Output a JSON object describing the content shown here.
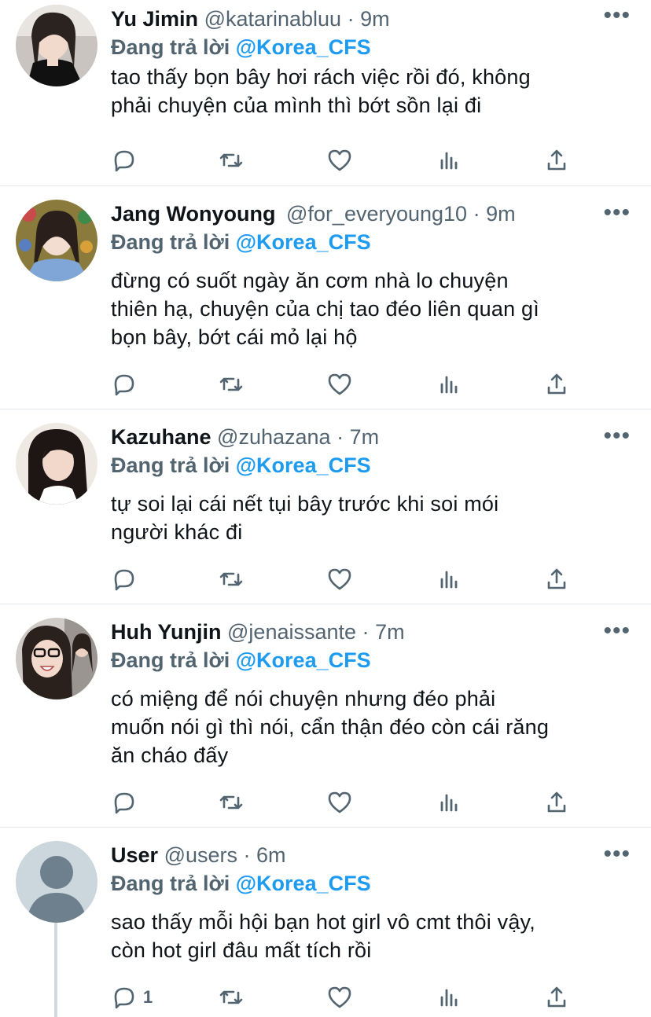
{
  "tweets": [
    {
      "name": "Yu Jimin",
      "handle": "@katarinabluu",
      "dot": "·",
      "time": "9m",
      "more": "•••",
      "reply_prefix": "Đang trả lời",
      "reply_to": "@Korea_CFS",
      "text_lines": [
        "tao thấy bọn bây hơi rách việc rồi đó, không",
        "phải chuyện của mình thì bớt sồn lại đi"
      ],
      "avatar": "profile-photo",
      "reply_count": ""
    },
    {
      "name": "Jang Wonyoung",
      "handle": "@for_everyoung10",
      "dot": "·",
      "time": "9m",
      "more": "•••",
      "reply_prefix": "Đang trả lời",
      "reply_to": "@Korea_CFS",
      "text_lines": [
        "đừng có suốt ngày ăn cơm nhà lo chuyện",
        "thiên hạ, chuyện của chị tao đéo liên quan gì",
        "bọn bây, bớt cái mỏ lại hộ"
      ],
      "avatar": "profile-photo",
      "reply_count": ""
    },
    {
      "name": "Kazuhane",
      "handle": "@zuhazana",
      "dot": "·",
      "time": "7m",
      "more": "•••",
      "reply_prefix": "Đang trả lời",
      "reply_to": "@Korea_CFS",
      "text_lines": [
        "tự soi lại cái nết tụi bây trước khi soi mói",
        "người khác đi"
      ],
      "avatar": "profile-photo",
      "reply_count": ""
    },
    {
      "name": "Huh Yunjin",
      "handle": "@jenaissante",
      "dot": "·",
      "time": "7m",
      "more": "•••",
      "reply_prefix": "Đang trả lời",
      "reply_to": "@Korea_CFS",
      "text_lines": [
        "có miệng để nói chuyện nhưng đéo phải",
        "muốn nói gì thì nói, cẩn thận đéo còn cái răng",
        "ăn cháo đấy"
      ],
      "avatar": "profile-photo",
      "reply_count": ""
    },
    {
      "name": "User",
      "handle": "@users",
      "dot": "·",
      "time": "6m",
      "more": "•••",
      "reply_prefix": "Đang trả lời",
      "reply_to": "@Korea_CFS",
      "text_lines": [
        "sao thấy mỗi hội bạn hot girl vô cmt thôi vậy,",
        "còn hot girl đâu mất tích rồi"
      ],
      "avatar": "default-avatar",
      "reply_count": "1"
    }
  ],
  "action_icons": [
    "reply-icon",
    "retweet-icon",
    "like-icon",
    "views-icon",
    "share-icon"
  ],
  "colors": {
    "accent": "#1d9bf0",
    "secondary_text": "#536471",
    "primary_text": "#0f1419",
    "divider": "#e1e6ea",
    "default_avatar_bg": "#ccd6dd",
    "default_avatar_fg": "#6e7f8d"
  }
}
